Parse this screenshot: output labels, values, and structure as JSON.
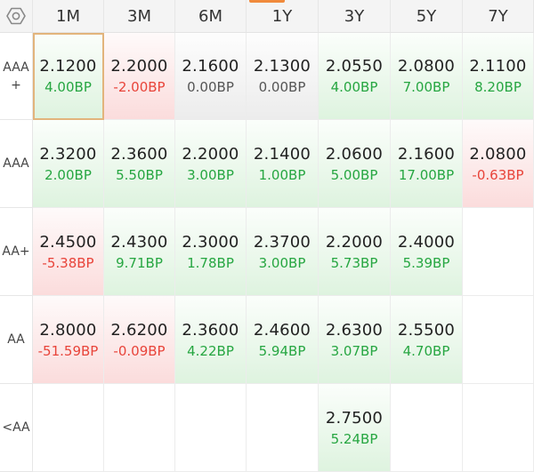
{
  "columns": [
    "1M",
    "3M",
    "6M",
    "1Y",
    "3Y",
    "5Y",
    "7Y"
  ],
  "settings_icon": "gear-hexagon-icon",
  "colors": {
    "up": "#26a641",
    "down": "#e8443a",
    "flat": "#555555",
    "selected_border": "#e2b47c",
    "accent": "#f08a3c"
  },
  "rows": [
    {
      "label": "AAA+",
      "cells": [
        {
          "rate": "2.1200",
          "change": "4.00BP",
          "trend": "up",
          "selected": true
        },
        {
          "rate": "2.2000",
          "change": "-2.00BP",
          "trend": "down"
        },
        {
          "rate": "2.1600",
          "change": "0.00BP",
          "trend": "flat"
        },
        {
          "rate": "2.1300",
          "change": "0.00BP",
          "trend": "flat"
        },
        {
          "rate": "2.0550",
          "change": "4.00BP",
          "trend": "up"
        },
        {
          "rate": "2.0800",
          "change": "7.00BP",
          "trend": "up"
        },
        {
          "rate": "2.1100",
          "change": "8.20BP",
          "trend": "up"
        }
      ]
    },
    {
      "label": "AAA",
      "cells": [
        {
          "rate": "2.3200",
          "change": "2.00BP",
          "trend": "up"
        },
        {
          "rate": "2.3600",
          "change": "5.50BP",
          "trend": "up"
        },
        {
          "rate": "2.2000",
          "change": "3.00BP",
          "trend": "up"
        },
        {
          "rate": "2.1400",
          "change": "1.00BP",
          "trend": "up"
        },
        {
          "rate": "2.0600",
          "change": "5.00BP",
          "trend": "up"
        },
        {
          "rate": "2.1600",
          "change": "17.00BP",
          "trend": "up"
        },
        {
          "rate": "2.0800",
          "change": "-0.63BP",
          "trend": "down"
        }
      ]
    },
    {
      "label": "AA+",
      "cells": [
        {
          "rate": "2.4500",
          "change": "-5.38BP",
          "trend": "down"
        },
        {
          "rate": "2.4300",
          "change": "9.71BP",
          "trend": "up"
        },
        {
          "rate": "2.3000",
          "change": "1.78BP",
          "trend": "up"
        },
        {
          "rate": "2.3700",
          "change": "3.00BP",
          "trend": "up"
        },
        {
          "rate": "2.2000",
          "change": "5.73BP",
          "trend": "up"
        },
        {
          "rate": "2.4000",
          "change": "5.39BP",
          "trend": "up"
        },
        null
      ]
    },
    {
      "label": "AA",
      "cells": [
        {
          "rate": "2.8000",
          "change": "-51.59BP",
          "trend": "down"
        },
        {
          "rate": "2.6200",
          "change": "-0.09BP",
          "trend": "down"
        },
        {
          "rate": "2.3600",
          "change": "4.22BP",
          "trend": "up"
        },
        {
          "rate": "2.4600",
          "change": "5.94BP",
          "trend": "up"
        },
        {
          "rate": "2.6300",
          "change": "3.07BP",
          "trend": "up"
        },
        {
          "rate": "2.5500",
          "change": "4.70BP",
          "trend": "up"
        },
        null
      ]
    },
    {
      "label": "<AA",
      "cells": [
        null,
        null,
        null,
        null,
        {
          "rate": "2.7500",
          "change": "5.24BP",
          "trend": "up"
        },
        null,
        null
      ]
    }
  ]
}
